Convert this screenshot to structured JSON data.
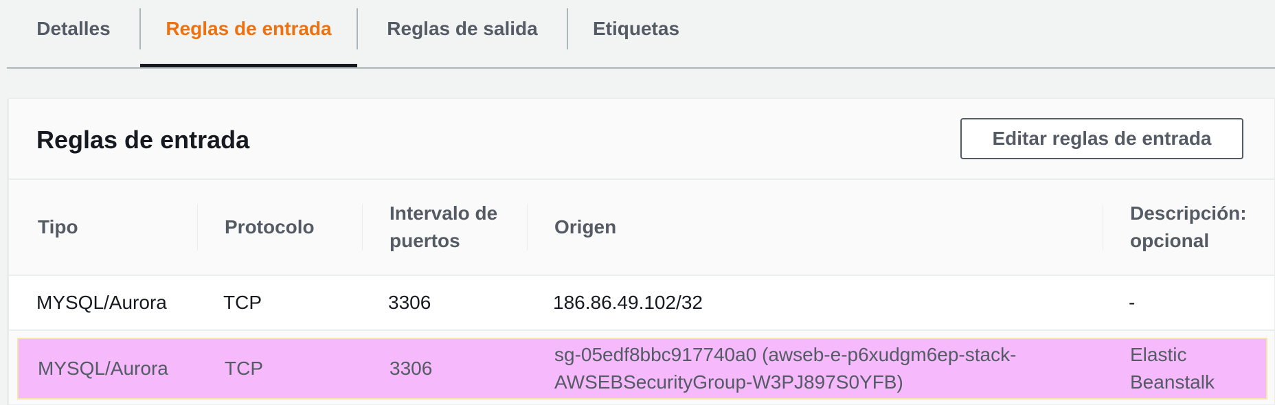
{
  "tabs": {
    "detalles": "Detalles",
    "reglas_entrada": "Reglas de entrada",
    "reglas_salida": "Reglas de salida",
    "etiquetas": "Etiquetas",
    "active": "Reglas de entrada"
  },
  "panel": {
    "title": "Reglas de entrada",
    "edit_button": "Editar reglas de entrada"
  },
  "table": {
    "headers": {
      "tipo": "Tipo",
      "protocolo": "Protocolo",
      "puertos": "Intervalo de puertos",
      "origen": "Origen",
      "descripcion": "Descripción: opcional"
    },
    "rows": [
      {
        "tipo": "MYSQL/Aurora",
        "protocolo": "TCP",
        "puertos": "3306",
        "origen": "186.86.49.102/32",
        "descripcion": "-"
      },
      {
        "tipo": "MYSQL/Aurora",
        "protocolo": "TCP",
        "puertos": "3306",
        "origen": "sg-05edf8bbc917740a0 (awseb-e-p6xudgm6ep-stack-AWSEBSecurityGroup-W3PJ897S0YFB)",
        "descripcion": "Elastic Beanstalk"
      }
    ]
  },
  "colors": {
    "active_tab": "#ec7211",
    "highlight_row": "#f5b9fc"
  }
}
